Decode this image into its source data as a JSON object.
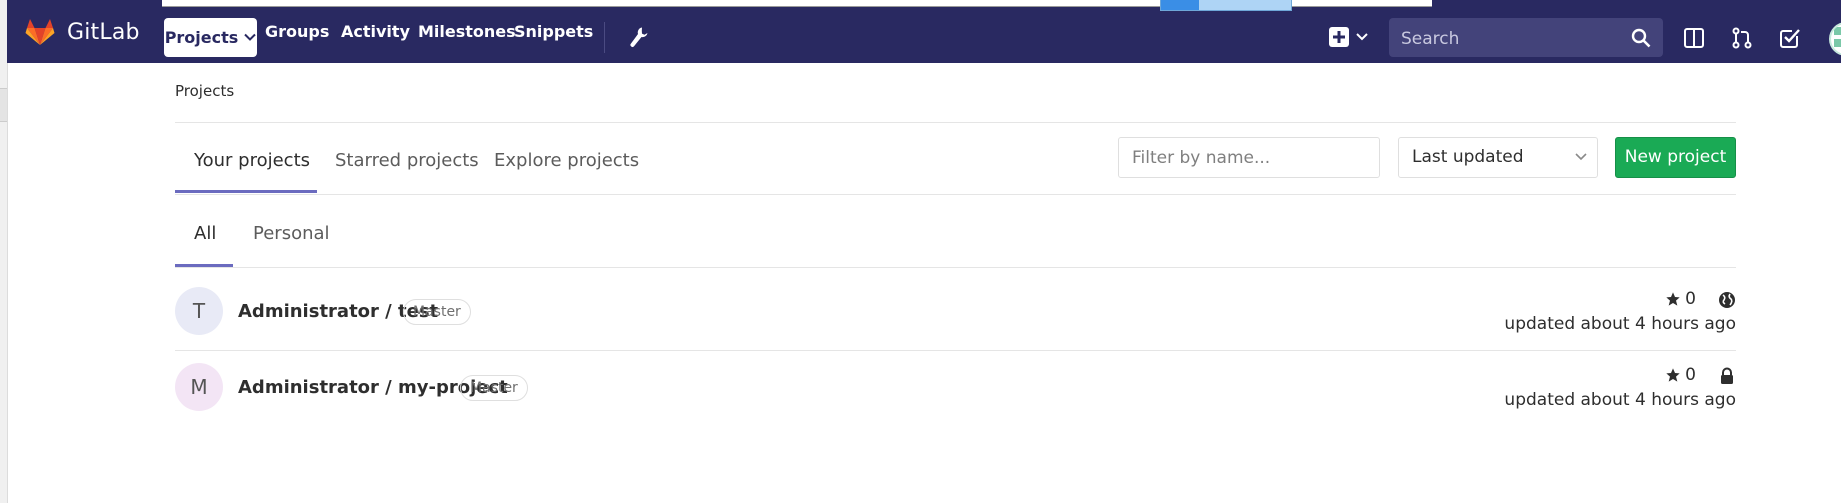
{
  "app": {
    "name": "GitLab"
  },
  "nav": {
    "items": [
      "Projects",
      "Groups",
      "Activity",
      "Milestones",
      "Snippets"
    ],
    "search_placeholder": "Search"
  },
  "breadcrumb": "Projects",
  "tabs": [
    "Your projects",
    "Starred projects",
    "Explore projects"
  ],
  "subtabs": [
    "All",
    "Personal"
  ],
  "filter": {
    "placeholder": "Filter by name..."
  },
  "sort": {
    "selected": "Last updated"
  },
  "new_project_label": "New project",
  "colors": {
    "navbar": "#292961",
    "accent": "#6b6bbf",
    "primary_button": "#1aaa55"
  },
  "projects": [
    {
      "avatar_letter": "T",
      "avatar_color": "#e8eaf6",
      "name": "Administrator / test",
      "role": "Master",
      "stars": "0",
      "visibility_icon": "globe-icon",
      "updated": "updated about 4 hours ago"
    },
    {
      "avatar_letter": "M",
      "avatar_color": "#f3e5f5",
      "name": "Administrator / my-project",
      "role": "Master",
      "stars": "0",
      "visibility_icon": "lock-icon",
      "updated": "updated about 4 hours ago"
    }
  ]
}
